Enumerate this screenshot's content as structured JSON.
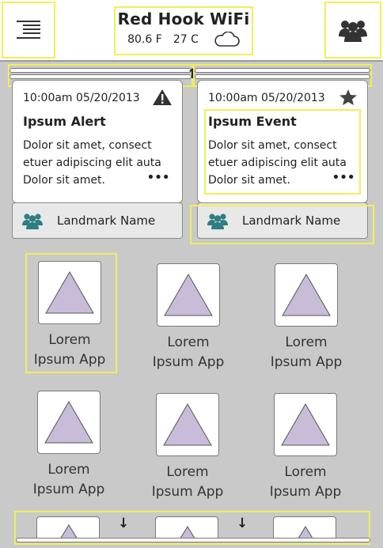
{
  "header": {
    "title": "Red Hook WiFi",
    "temp_f": "80.6 F",
    "temp_c": "27 C",
    "menu_icon": "hamburger-menu-icon",
    "weather_icon": "cloud-icon",
    "people_icon": "people-group-icon"
  },
  "cards": [
    {
      "timestamp": "10:00am 05/20/2013",
      "title": "Ipsum Alert",
      "body": "Dolor sit amet, consect etuer adipiscing elit auta Dolor sit amet.",
      "more": "•••",
      "icon": "warning-icon",
      "landmark": "Landmark Name"
    },
    {
      "timestamp": "10:00am 05/20/2013",
      "title": "Ipsum Event",
      "body": "Dolor sit amet, consect etuer adipiscing elit auta Dolor sit amet.",
      "more": "•••",
      "icon": "star-icon",
      "landmark": "Landmark Name"
    }
  ],
  "scroll": {
    "up": "↑",
    "down": "↓"
  },
  "apps": [
    {
      "line1": "Lorem",
      "line2": "Ipsum App"
    },
    {
      "line1": "Lorem",
      "line2": "Ipsum App"
    },
    {
      "line1": "Lorem",
      "line2": "Ipsum App"
    },
    {
      "line1": "Lorem",
      "line2": "Ipsum App"
    },
    {
      "line1": "Lorem",
      "line2": "Ipsum App"
    },
    {
      "line1": "Lorem",
      "line2": "Ipsum App"
    }
  ],
  "colors": {
    "highlight": "#f1ee5a",
    "triangle_fill": "#c8bcd9",
    "people_icon": "#2f7d84",
    "background": "#c9c9c9"
  }
}
